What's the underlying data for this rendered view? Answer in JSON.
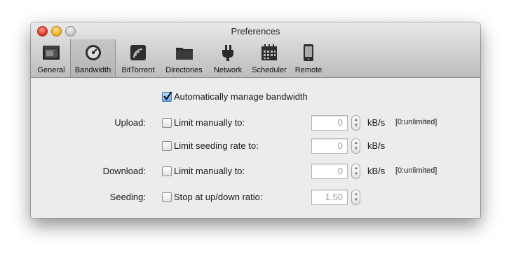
{
  "window": {
    "title": "Preferences"
  },
  "toolbar": {
    "tabs": [
      {
        "label": "General",
        "icon": "general-icon"
      },
      {
        "label": "Bandwidth",
        "icon": "gauge-icon",
        "selected": true
      },
      {
        "label": "BitTorrent",
        "icon": "bittorrent-icon"
      },
      {
        "label": "Directories",
        "icon": "folder-icon"
      },
      {
        "label": "Network",
        "icon": "plug-icon"
      },
      {
        "label": "Scheduler",
        "icon": "calendar-icon"
      },
      {
        "label": "Remote",
        "icon": "phone-icon"
      }
    ]
  },
  "bandwidth": {
    "auto_manage": {
      "label": "Automatically manage bandwidth",
      "checked": true
    },
    "upload": {
      "row_label": "Upload:",
      "limit_manual": {
        "label": "Limit manually to:",
        "checked": false,
        "value": "0",
        "unit": "kB/s",
        "hint": "[0:unlimited]"
      },
      "limit_seeding": {
        "label": "Limit seeding rate to:",
        "checked": false,
        "value": "0",
        "unit": "kB/s"
      }
    },
    "download": {
      "row_label": "Download:",
      "limit_manual": {
        "label": "Limit manually to:",
        "checked": false,
        "value": "0",
        "unit": "kB/s",
        "hint": "[0:unlimited]"
      }
    },
    "seeding": {
      "row_label": "Seeding:",
      "stop_ratio": {
        "label": "Stop at up/down ratio:",
        "checked": false,
        "value": "1.50"
      }
    }
  }
}
